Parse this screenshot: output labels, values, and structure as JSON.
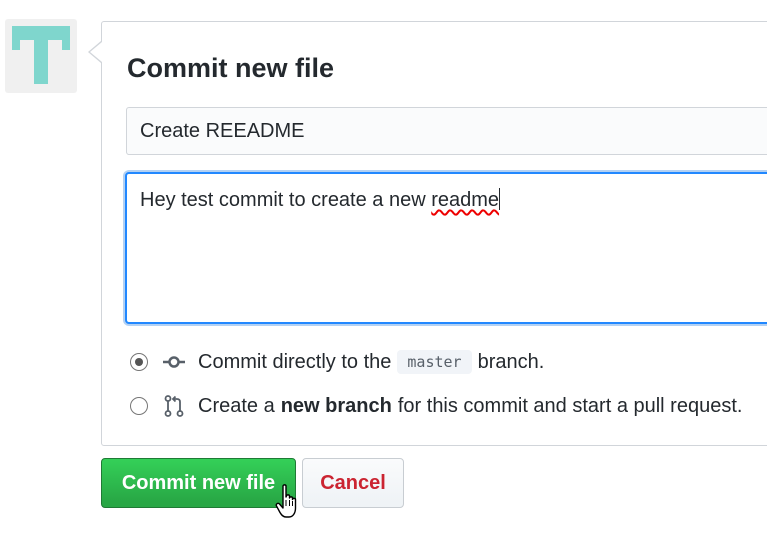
{
  "form": {
    "title": "Commit new file",
    "summary_value": "Create REEADME",
    "description_prefix": "Hey test commit to create a new ",
    "description_misspelled": "readme"
  },
  "options": {
    "direct": {
      "prefix": "Commit directly to the",
      "branch": "master",
      "suffix": "branch."
    },
    "new_branch": {
      "prefix": "Create a",
      "emphasis": "new branch",
      "suffix": "for this commit and start a pull request."
    }
  },
  "buttons": {
    "commit_label": "Commit new file",
    "cancel_label": "Cancel"
  },
  "colors": {
    "primary": "#28a745",
    "danger": "#cb2431",
    "focus": "#2188ff",
    "avatar": "#7fd6cd"
  },
  "icons": [
    "avatar-identicon",
    "git-commit-icon",
    "git-pull-request-icon",
    "hand-pointer-icon"
  ]
}
